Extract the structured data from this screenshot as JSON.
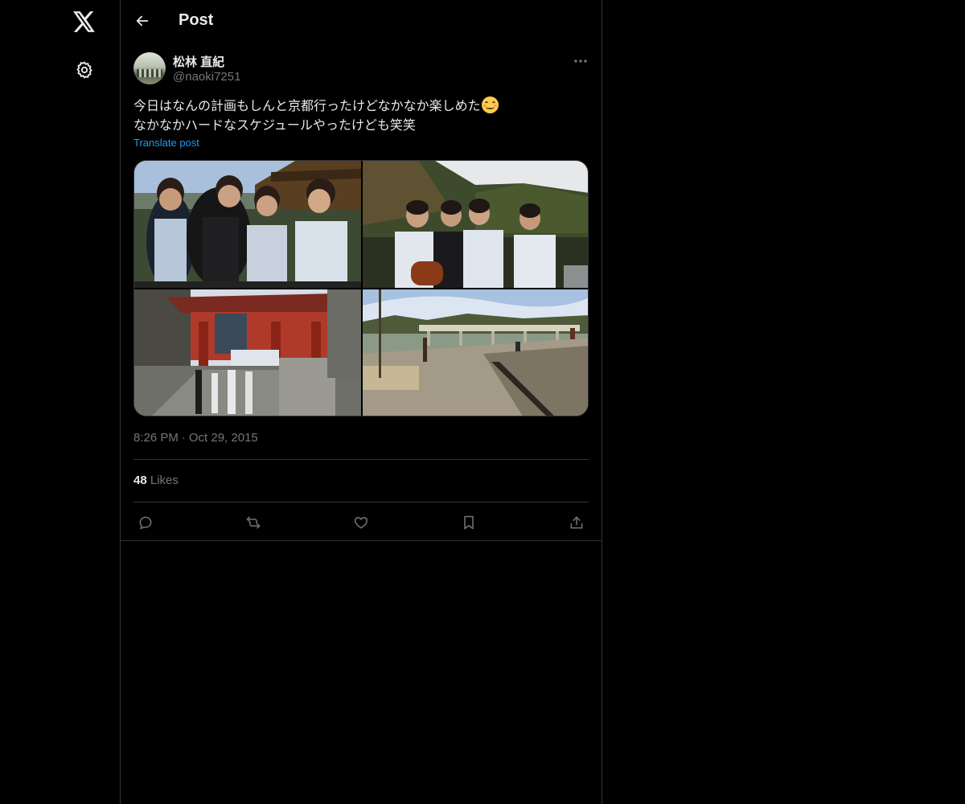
{
  "header": {
    "title": "Post"
  },
  "nav": {
    "logo_icon": "x-logo-icon",
    "settings_icon": "gear-icon"
  },
  "post": {
    "author": {
      "display_name": "松林 直紀",
      "handle": "@naoki7251"
    },
    "text_line1": "今日はなんの計画もしんと京都行ったけどなかなか楽しめた",
    "text_line1_emoji": "smiling-face-emoji",
    "text_line2": "なかなかハードなスケジュールやったけども笑笑",
    "translate_label": "Translate post",
    "time": "8:26 PM",
    "separator": "·",
    "date": "Oct 29, 2015",
    "likes_count": "48",
    "likes_label": "Likes",
    "media_count": 4
  },
  "actions": [
    "reply-icon",
    "repost-icon",
    "like-icon",
    "bookmark-icon",
    "share-icon"
  ],
  "colors": {
    "background": "#000000",
    "text": "#e7e9ea",
    "muted": "#71767b",
    "link": "#1d9bf0",
    "border": "#2f3336"
  }
}
